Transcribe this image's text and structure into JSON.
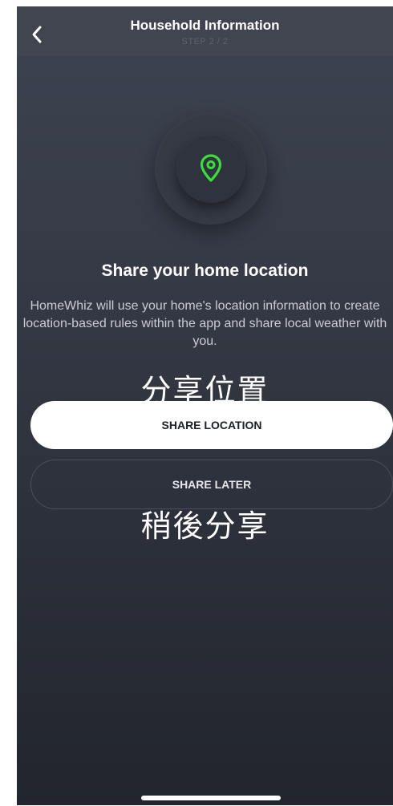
{
  "header": {
    "title": "Household Information",
    "step": "STEP 2 / 2"
  },
  "hero": {
    "icon": "location-pin-icon",
    "icon_color": "#3ddc3d"
  },
  "content": {
    "heading": "Share your home location",
    "description": "HomeWhiz will use your home's location information to create location-based rules within the app and share local weather with you."
  },
  "annotations": {
    "share_location_cn": "分享位置",
    "share_later_cn": "稍後分享"
  },
  "buttons": {
    "share_location": "SHARE LOCATION",
    "share_later": "SHARE LATER"
  },
  "colors": {
    "background_top": "#3d4350",
    "background_bottom": "#22252d",
    "accent": "#3ddc3d"
  }
}
